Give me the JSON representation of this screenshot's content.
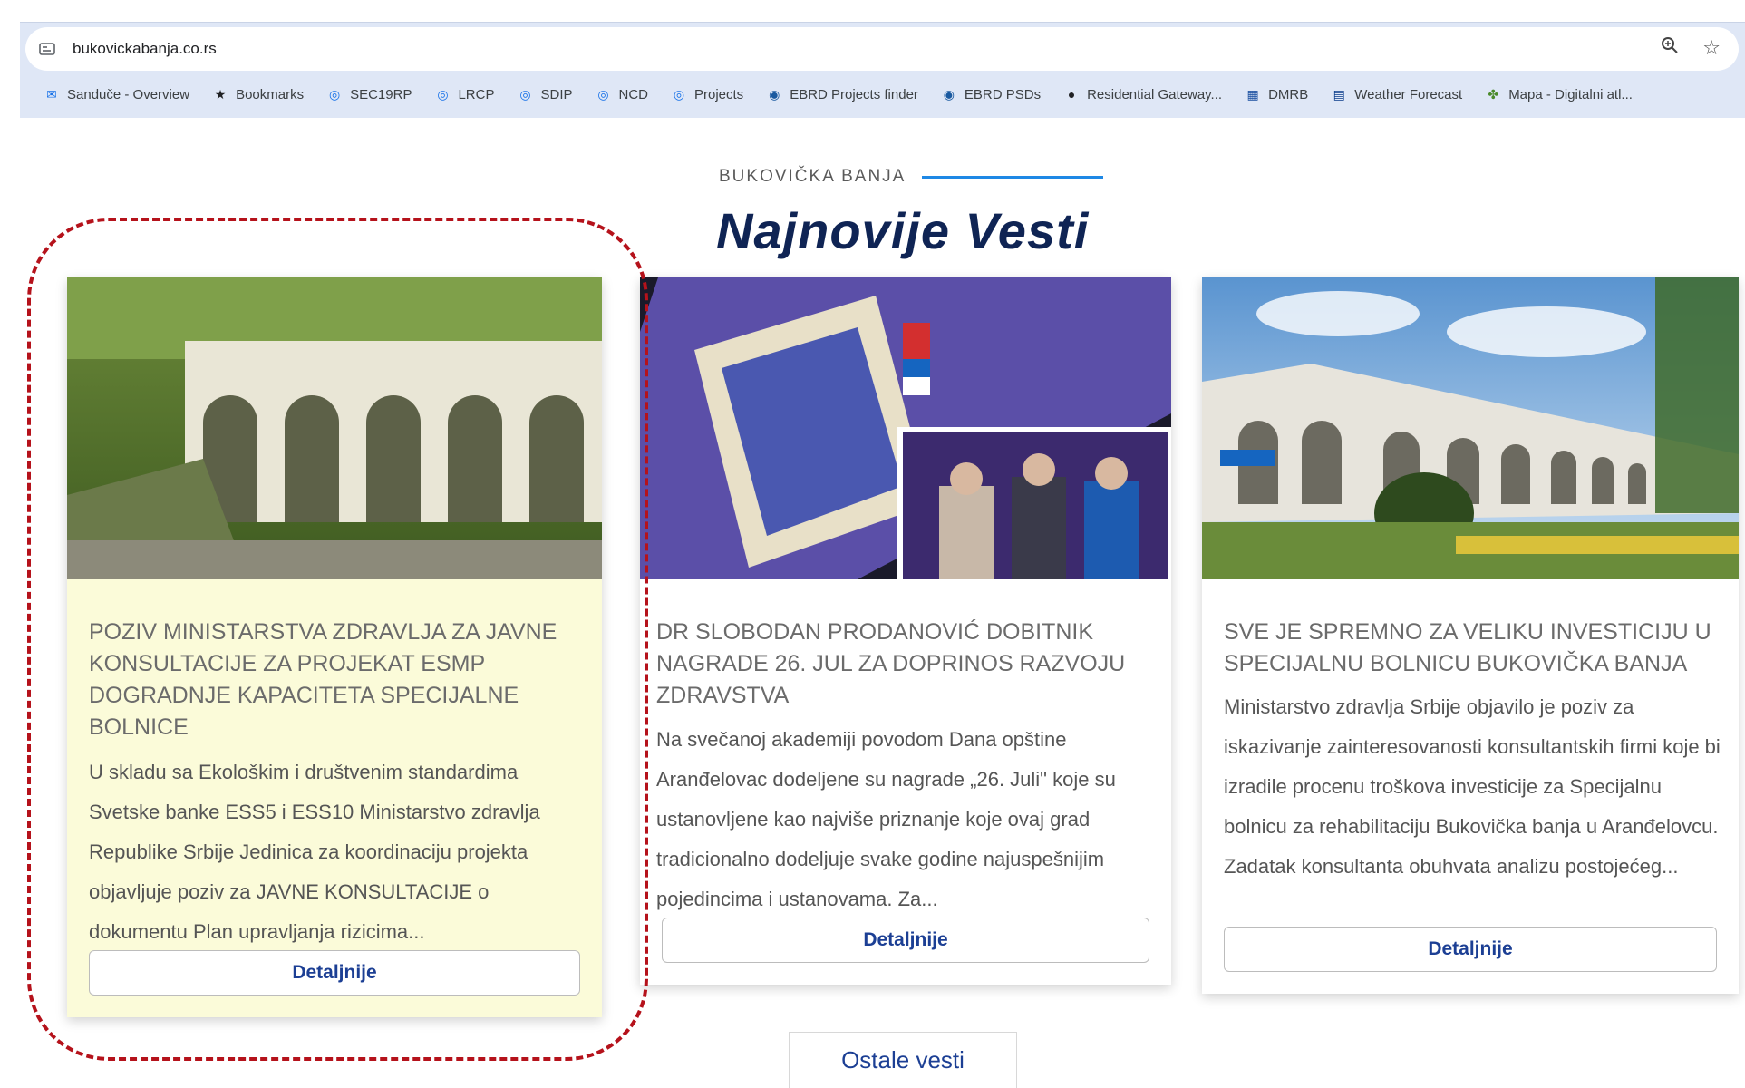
{
  "browser": {
    "url": "bukovickabanja.co.rs",
    "bookmarks": [
      {
        "label": "Sanduče - Overview",
        "icon": "mail-icon"
      },
      {
        "label": "Bookmarks",
        "icon": "star-icon"
      },
      {
        "label": "SEC19RP",
        "icon": "globe-icon"
      },
      {
        "label": "LRCP",
        "icon": "globe-icon"
      },
      {
        "label": "SDIP",
        "icon": "globe-icon"
      },
      {
        "label": "NCD",
        "icon": "globe-icon"
      },
      {
        "label": "Projects",
        "icon": "globe-icon"
      },
      {
        "label": "EBRD Projects finder",
        "icon": "ebrd-icon"
      },
      {
        "label": "EBRD PSDs",
        "icon": "ebrd-icon"
      },
      {
        "label": "Residential Gateway...",
        "icon": "residential-icon"
      },
      {
        "label": "DMRB",
        "icon": "dmrb-icon"
      },
      {
        "label": "Weather Forecast",
        "icon": "weather-icon"
      },
      {
        "label": "Mapa - Digitalni atl...",
        "icon": "map-icon"
      }
    ]
  },
  "section": {
    "eyebrow": "BUKOVIČKA BANJA",
    "title": "Najnovije Vesti",
    "accent_color": "#1e88e5",
    "title_color": "#0f2454"
  },
  "cards": [
    {
      "headline": "POZIV MINISTARSTVA ZDRAVLJA ZA JAVNE KONSULTACIJE ZA PROJEKAT ESMP DOGRADNJE KAPACITETA SPECIJALNE BOLNICE",
      "excerpt": "U skladu sa Ekološkim i društvenim standardima Svetske banke ESS5 i ESS10 Ministarstvo zdravlja Republike Srbije Jedinica za koordinaciju projekta objavljuje poziv za JAVNE KONSULTACIJE o dokumentu Plan upravljanja rizicima...",
      "button": "Detaljnije"
    },
    {
      "headline": "DR SLOBODAN PRODANOVIĆ DOBITNIK NAGRADE 26. JUL ZA DOPRINOS RAZVOJU ZDRAVSTVA",
      "excerpt": "Na svečanoj akademiji povodom Dana opštine Aranđelovac dodeljene su nagrade „26. Juli\" koje su ustanovljene kao najviše priznanje koje ovaj grad tradicionalno dodeljuje svake godine najuspešnijim pojedincima i ustanovama. Za...",
      "button": "Detaljnije"
    },
    {
      "headline": "SVE JE SPREMNO ZA VELIKU INVESTICIJU U SPECIJALNU BOLNICU BUKOVIČKA BANJA",
      "excerpt": "Ministarstvo zdravlja Srbije objavilo je poziv za iskazivanje zainteresovanosti konsultantskih firmi koje bi izradile procenu troškova investicije za Specijalnu bolnicu za rehabilitaciju Bukovička banja u Aranđelovcu. Zadatak konsultanta obuhvata analizu postojećeg...",
      "button": "Detaljnije"
    }
  ],
  "more_button": "Ostale vesti",
  "highlight_color": "#b5121b"
}
